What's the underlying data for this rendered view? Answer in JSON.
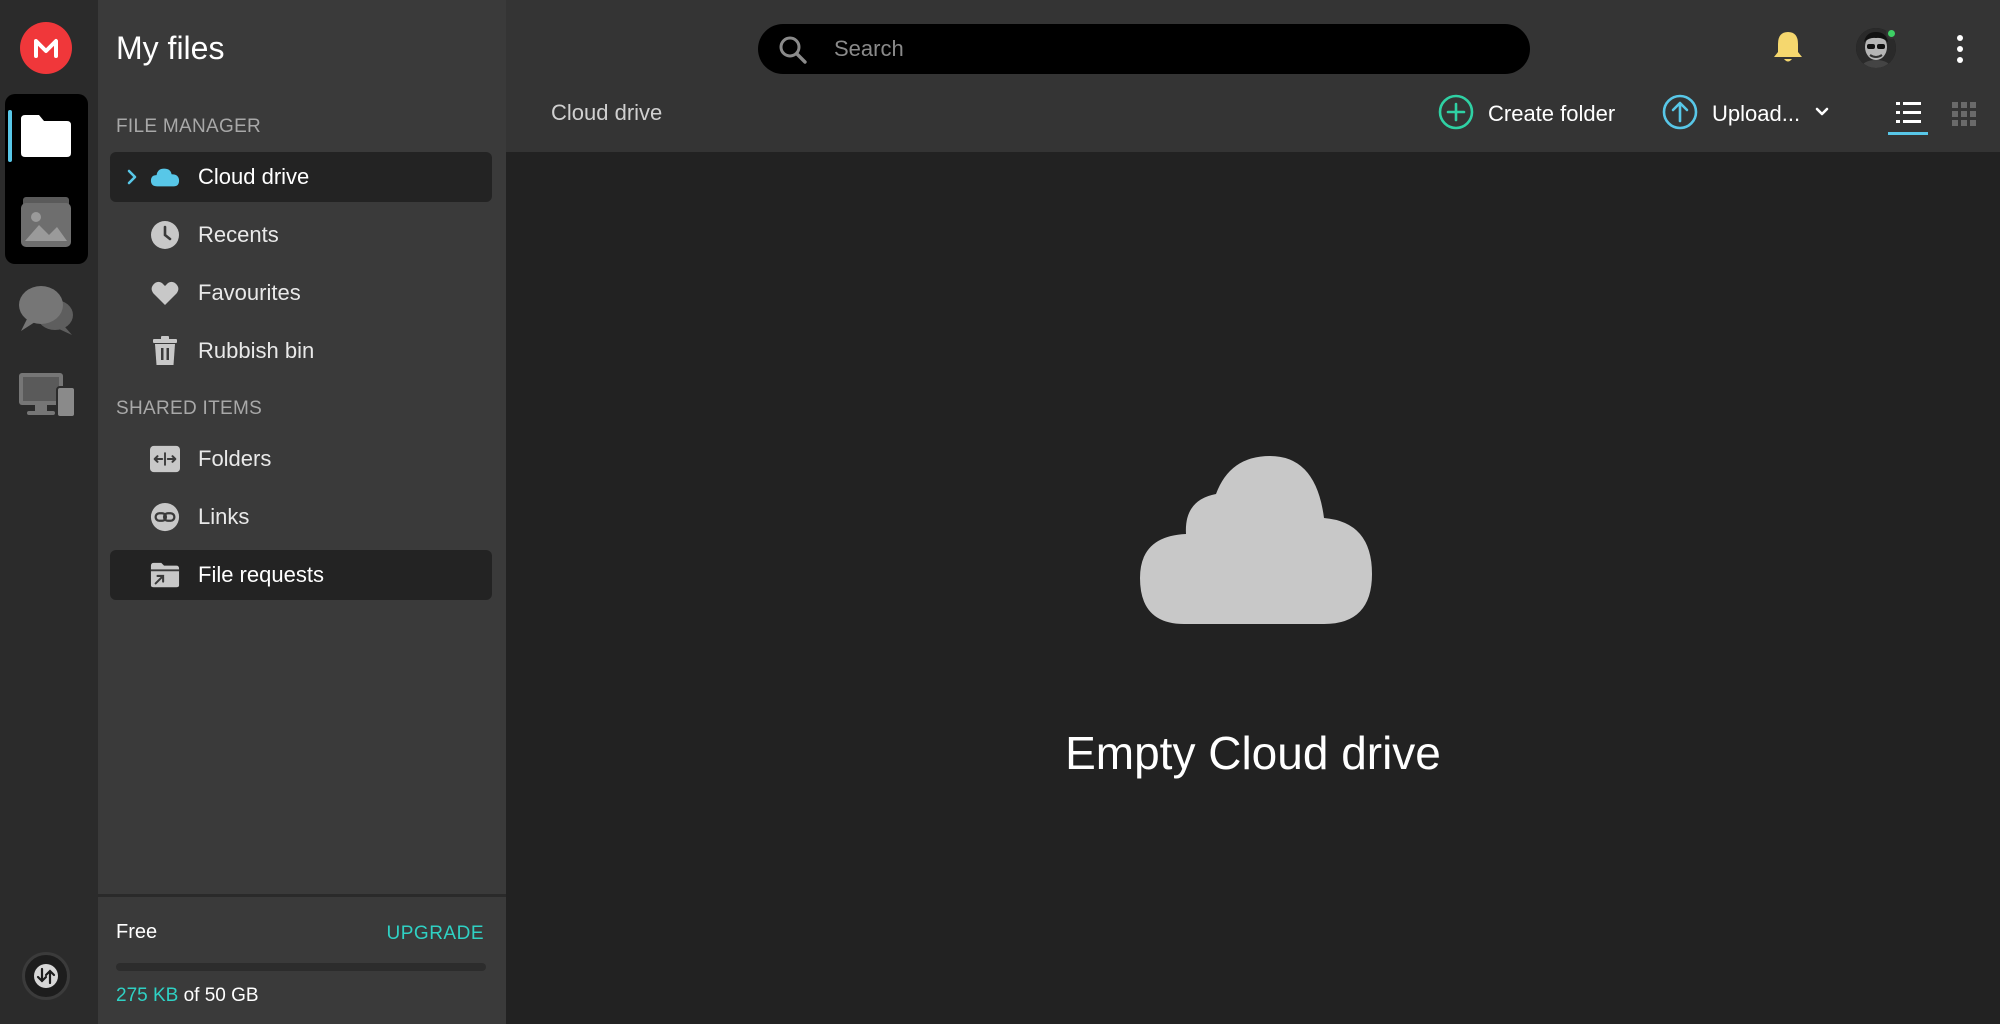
{
  "rail": {
    "logo_letter": "M",
    "icons": [
      "mega-logo-icon",
      "folder-icon",
      "photos-icon",
      "chat-icon",
      "devices-icon",
      "transfers-icon"
    ]
  },
  "sidebar": {
    "title": "My files",
    "file_manager_label": "FILE MANAGER",
    "file_manager_items": [
      {
        "label": "Cloud drive",
        "icon": "cloud-icon",
        "selected": true
      },
      {
        "label": "Recents",
        "icon": "clock-icon"
      },
      {
        "label": "Favourites",
        "icon": "heart-icon"
      },
      {
        "label": "Rubbish bin",
        "icon": "trash-icon"
      }
    ],
    "shared_label": "SHARED ITEMS",
    "shared_items": [
      {
        "label": "Folders",
        "icon": "shared-folder-icon"
      },
      {
        "label": "Links",
        "icon": "link-icon"
      },
      {
        "label": "File requests",
        "icon": "file-request-icon",
        "hovered": true
      }
    ],
    "storage": {
      "plan": "Free",
      "upgrade": "UPGRADE",
      "used": "275 KB",
      "of_total": " of 50 GB",
      "used_fraction": 5.5e-06
    }
  },
  "header": {
    "search_placeholder": "Search",
    "breadcrumb": "Cloud drive",
    "create_folder": "Create folder",
    "upload": "Upload..."
  },
  "main": {
    "empty_title": "Empty Cloud drive"
  },
  "colors": {
    "accent_teal": "#2fd1c4",
    "accent_blue": "#58c7e8",
    "brand_red": "#f0373a",
    "bell_yellow": "#f5d76e",
    "online_green": "#3ed065"
  }
}
